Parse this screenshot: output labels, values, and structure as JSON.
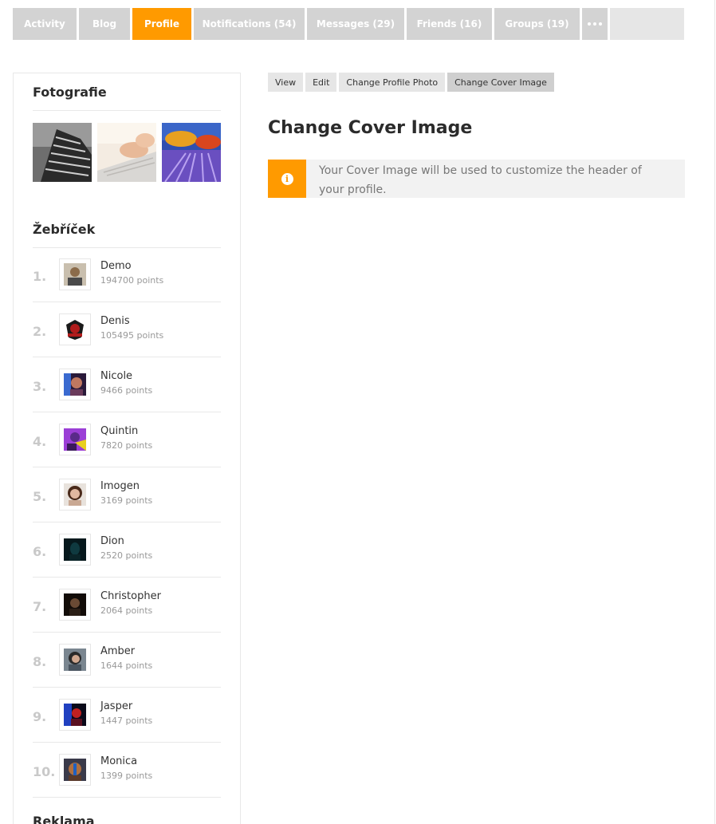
{
  "topnav": {
    "tabs": [
      {
        "label": "Activity",
        "w": 80
      },
      {
        "label": "Blog",
        "w": 64
      },
      {
        "label": "Profile",
        "w": 74,
        "active": true
      },
      {
        "label": "Notifications (54)",
        "w": 139
      },
      {
        "label": "Messages (29)",
        "w": 122
      },
      {
        "label": "Friends (16)",
        "w": 107
      },
      {
        "label": "Groups (19)",
        "w": 107
      }
    ],
    "more_icon": "ellipsis-icon"
  },
  "sidebar": {
    "photos_title": "Fotografie",
    "ranking_title": "Žebříček",
    "ads_title": "Reklama",
    "ranking": [
      {
        "rank": "1.",
        "name": "Demo",
        "points": "194700 points",
        "color": "#8b6b4a"
      },
      {
        "rank": "2.",
        "name": "Denis",
        "points": "105495 points",
        "color": "#b01c1c"
      },
      {
        "rank": "3.",
        "name": "Nicole",
        "points": "9466 points",
        "color": "#6a3a5a"
      },
      {
        "rank": "4.",
        "name": "Quintin",
        "points": "7820 points",
        "color": "#9b3fd6"
      },
      {
        "rank": "5.",
        "name": "Imogen",
        "points": "3169 points",
        "color": "#c9a893"
      },
      {
        "rank": "6.",
        "name": "Dion",
        "points": "2520 points",
        "color": "#0f3a40"
      },
      {
        "rank": "7.",
        "name": "Christopher",
        "points": "2064 points",
        "color": "#2a1e16"
      },
      {
        "rank": "8.",
        "name": "Amber",
        "points": "1644 points",
        "color": "#4a5560"
      },
      {
        "rank": "9.",
        "name": "Jasper",
        "points": "1447 points",
        "color": "#5a1020"
      },
      {
        "rank": "10.",
        "name": "Monica",
        "points": "1399 points",
        "color": "#b07040"
      }
    ]
  },
  "main": {
    "subtabs": [
      {
        "label": "View"
      },
      {
        "label": "Edit"
      },
      {
        "label": "Change Profile Photo"
      },
      {
        "label": "Change Cover Image",
        "active": true
      }
    ],
    "title": "Change Cover Image",
    "notice": "Your Cover Image will be used to customize the header of your profile."
  },
  "colors": {
    "accent": "#ff9a00",
    "tab_bg": "#d3d3d3",
    "notice_bg": "#f2f2f2"
  }
}
